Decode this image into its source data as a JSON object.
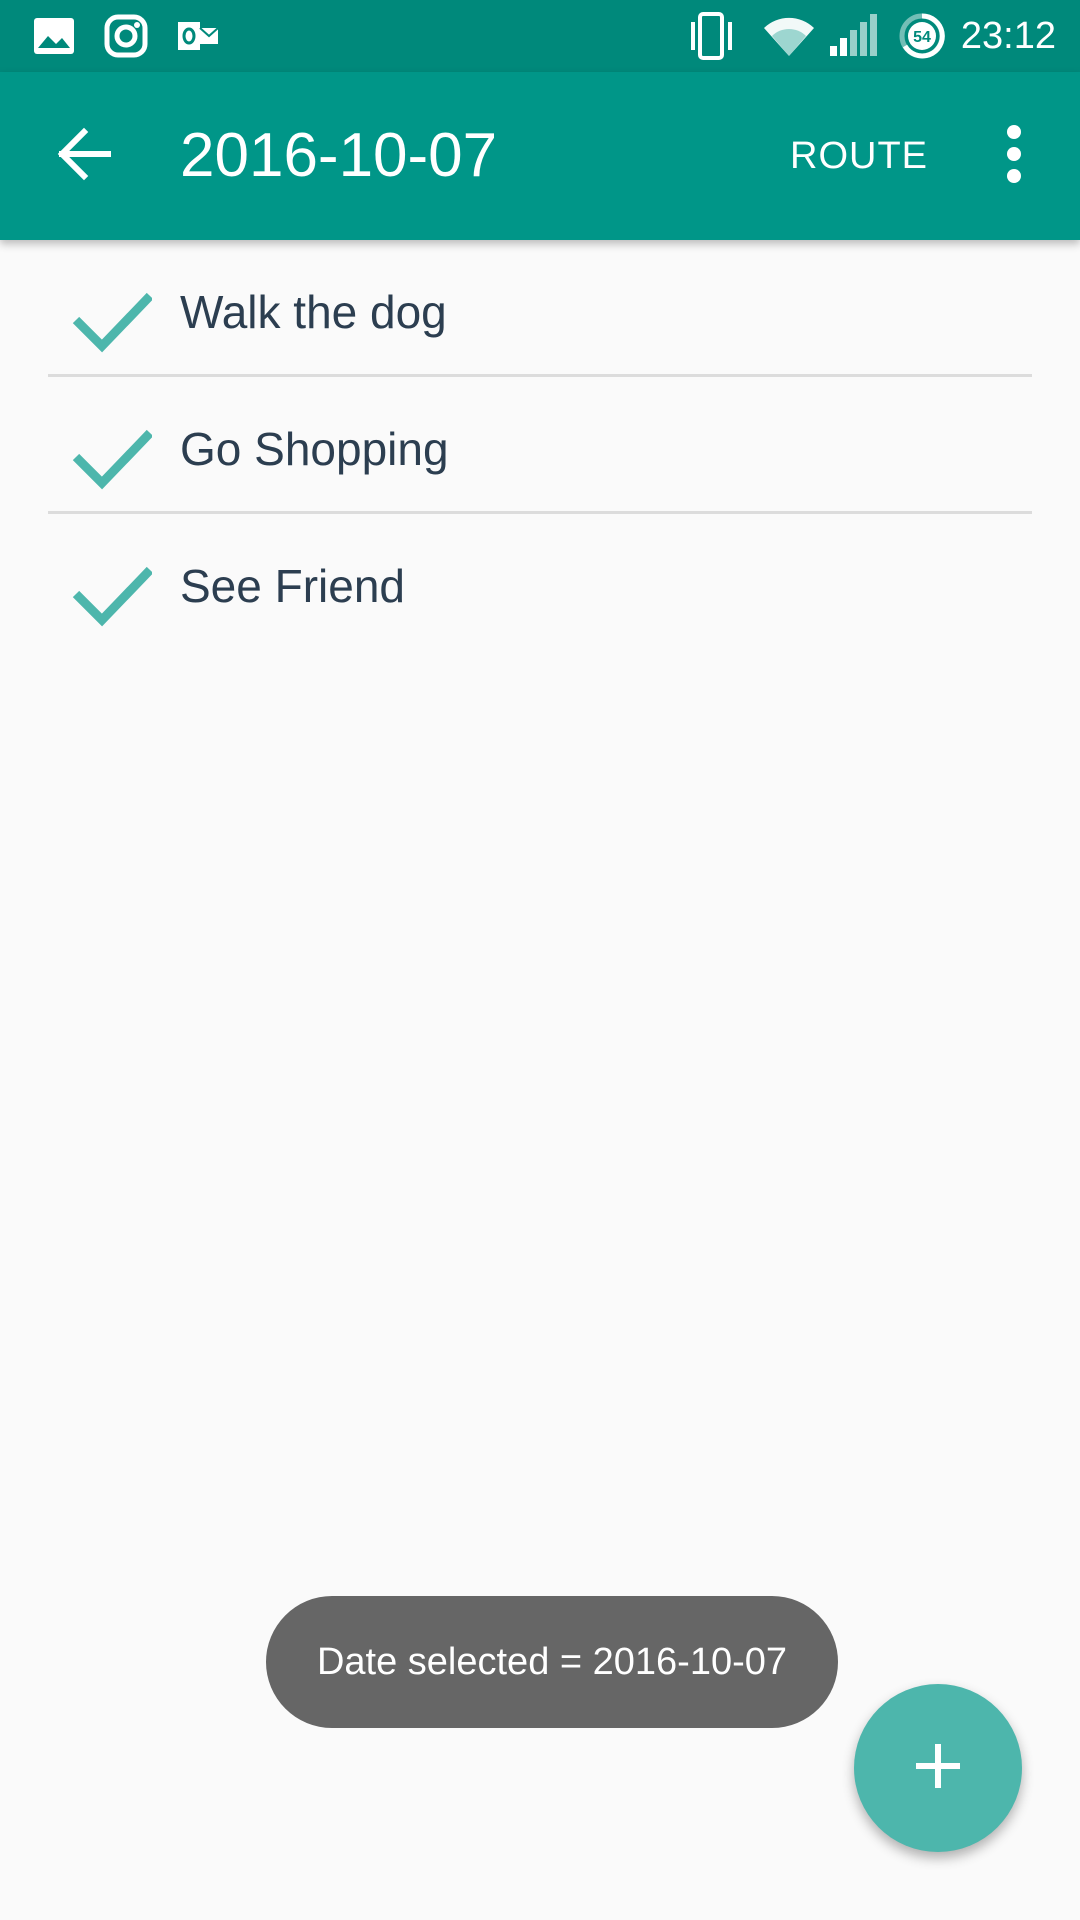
{
  "status_bar": {
    "time": "23:12",
    "battery_level": "54",
    "icons": [
      "gallery-icon",
      "instagram-icon",
      "outlook-icon",
      "vibrate-icon",
      "wifi-icon",
      "signal-icon",
      "battery-icon"
    ]
  },
  "app_bar": {
    "title": "2016-10-07",
    "route_label": "ROUTE",
    "icons": [
      "back-arrow-icon",
      "more-vert-icon"
    ]
  },
  "tasks": [
    {
      "label": "Walk the dog"
    },
    {
      "label": "Go Shopping"
    },
    {
      "label": "See Friend"
    }
  ],
  "toast": {
    "message": "Date selected = 2016-10-07"
  },
  "fab": {
    "icon": "plus-icon"
  },
  "colors": {
    "status_bar": "#00897b",
    "app_bar": "#009688",
    "accent": "#4db6ac",
    "text": "#2c3e50",
    "toast": "#666666"
  }
}
